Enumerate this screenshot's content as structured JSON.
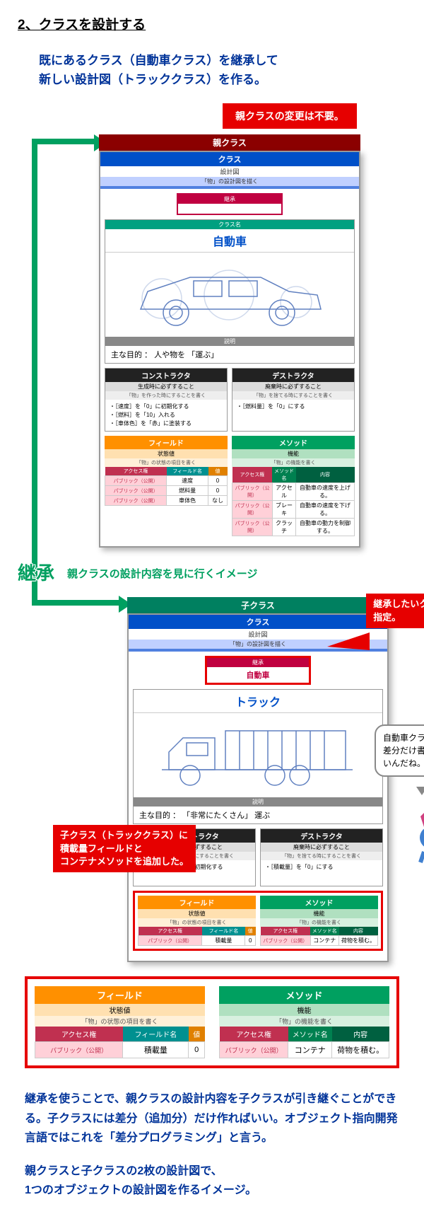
{
  "heading": "2、クラスを設計する",
  "intro": "既にあるクラス（自動車クラス）を継承して\n新しい設計図（トラッククラス）を作る。",
  "note_parent": "親クラスの変更は不要。",
  "parent": {
    "bar": "親クラス",
    "cls_label": "クラス",
    "sub1": "設計図",
    "sub2": "「物」の設計図を描く",
    "inh_h": "継承",
    "inh_v": "",
    "name_h": "クラス名",
    "name": "自動車",
    "desc_h": "説明",
    "desc": "主な目的 ： 人や物を 「運ぶ」",
    "cons": {
      "h": "コンストラクタ",
      "sh": "生成時に必ずすること",
      "sb": "「物」を作った時にすることを書く",
      "items": [
        "・［速度］を「0」に初期化する",
        "・［燃料］を「10」入れる",
        "・［車体色］を「赤」に塗装する"
      ]
    },
    "dest": {
      "h": "デストラクタ",
      "sh": "廃棄時に必ずすること",
      "sb": "「物」を捨てる時にすることを書く",
      "items": [
        "・［燃料量］を「0」にする"
      ]
    },
    "field": {
      "h": "フィールド",
      "sh": "状態値",
      "sb": "「物」の状態の項目を書く",
      "cols": [
        "アクセス権",
        "フィールド名",
        "値"
      ],
      "rows": [
        [
          "パブリック（公開）",
          "速度",
          "0"
        ],
        [
          "パブリック（公開）",
          "燃料量",
          "0"
        ],
        [
          "パブリック（公開）",
          "車体色",
          "なし"
        ]
      ]
    },
    "method": {
      "h": "メソッド",
      "sh": "機能",
      "sb": "「物」の機能を書く",
      "cols": [
        "アクセス権",
        "メソッド名",
        "内容"
      ],
      "rows": [
        [
          "パブリック（公開）",
          "アクセル",
          "自動車の速度を上げる。"
        ],
        [
          "パブリック（公開）",
          "ブレーキ",
          "自動車の速度を下げる。"
        ],
        [
          "パブリック（公開）",
          "クラッチ",
          "自動車の動力を制御する。"
        ]
      ]
    }
  },
  "inh_big": "継承",
  "inh_note": "親クラスの設計内容を見に行くイメージ",
  "child": {
    "bar": "子クラス",
    "cls_label": "クラス",
    "sub1": "設計図",
    "sub2": "「物」の設計図を描く",
    "inh_h": "継承",
    "inh_v": "自動車",
    "name": "トラック",
    "desc": "主な目的 ： 「非常にたくさん」 運ぶ",
    "cons": {
      "h": "コンストラクタ",
      "sh": "生成時に必ずすること",
      "sb": "「物」を作った時にすることを書く",
      "items": [
        "・［積載量］を「0」に初期化する"
      ]
    },
    "dest": {
      "h": "デストラクタ",
      "sh": "廃棄時に必ずすること",
      "sb": "「物」を捨てる時にすることを書く",
      "items": [
        "・［積載量］を「0」にする"
      ]
    },
    "field": {
      "h": "フィールド",
      "sh": "状態値",
      "sb": "「物」の状態の項目を書く",
      "cols": [
        "アクセス権",
        "フィールド名",
        "値"
      ],
      "rows": [
        [
          "パブリック（公開）",
          "積載量",
          "0"
        ]
      ]
    },
    "method": {
      "h": "メソッド",
      "sh": "機能",
      "sb": "「物」の機能を書く",
      "cols": [
        "アクセス権",
        "メソッド名",
        "内容"
      ],
      "rows": [
        [
          "パブリック（公開）",
          "コンテナ",
          "荷物を積む。"
        ]
      ]
    }
  },
  "callout_specify": "継承したいクラスを\n指定。",
  "bubble": "自動車クラスとの差分だけ書けばいいんだね。",
  "callout_added": "子クラス（トラッククラス）に\n積載量フィールドと\nコンテナメソッドを追加した。",
  "zoom": {
    "field": {
      "h": "フィールド",
      "sh": "状態値",
      "sb": "「物」の状態の項目を書く",
      "cols": [
        "アクセス権",
        "フィールド名",
        "値"
      ],
      "rows": [
        [
          "パブリック（公開）",
          "積載量",
          "0"
        ]
      ]
    },
    "method": {
      "h": "メソッド",
      "sh": "機能",
      "sb": "「物」の機能を書く",
      "cols": [
        "アクセス権",
        "メソッド名",
        "内容"
      ],
      "rows": [
        [
          "パブリック（公開）",
          "コンテナ",
          "荷物を積む。"
        ]
      ]
    }
  },
  "outro1": "継承を使うことで、親クラスの設計内容を子クラスが引き継ぐことができる。子クラスには差分（追加分）だけ作ればいい。オブジェクト指向開発言語ではこれを「差分プログラミング」と言う。",
  "outro2": "親クラスと子クラスの2枚の設計図で、\n1つのオブジェクトの設計図を作るイメージ。"
}
